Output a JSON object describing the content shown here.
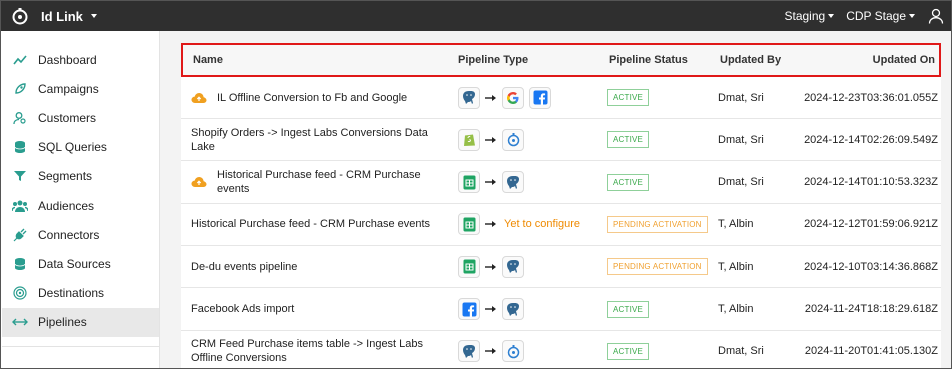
{
  "app": {
    "name": "Id Link"
  },
  "topbar": {
    "env1": "Staging",
    "env2": "CDP Stage"
  },
  "sidebar": {
    "items": [
      {
        "label": "Dashboard",
        "icon": "trend-line-icon"
      },
      {
        "label": "Campaigns",
        "icon": "rocket-icon"
      },
      {
        "label": "Customers",
        "icon": "user-search-icon"
      },
      {
        "label": "SQL Queries",
        "icon": "database-icon"
      },
      {
        "label": "Segments",
        "icon": "filter-icon"
      },
      {
        "label": "Audiences",
        "icon": "users-group-icon"
      },
      {
        "label": "Connectors",
        "icon": "plug-icon"
      },
      {
        "label": "Data Sources",
        "icon": "database-icon"
      },
      {
        "label": "Destinations",
        "icon": "target-icon"
      },
      {
        "label": "Pipelines",
        "icon": "horizontal-arrows-icon",
        "active": true
      }
    ]
  },
  "table": {
    "headers": {
      "name": "Name",
      "type": "Pipeline Type",
      "status": "Pipeline Status",
      "by": "Updated By",
      "on": "Updated On"
    },
    "rows": [
      {
        "name": "IL Offline Conversion to Fb and Google",
        "cloud": true,
        "source": "postgres",
        "dest": [
          "google",
          "facebook"
        ],
        "status": "ACTIVE",
        "by": "Dmat, Sri",
        "on": "2024-12-23T03:36:01.055Z"
      },
      {
        "name": "Shopify Orders -> Ingest Labs Conversions Data Lake",
        "cloud": false,
        "source": "shopify",
        "dest": [
          "ingestlabs"
        ],
        "status": "ACTIVE",
        "by": "Dmat, Sri",
        "on": "2024-12-14T02:26:09.549Z"
      },
      {
        "name": "Historical Purchase feed - CRM Purchase events",
        "cloud": true,
        "source": "sheets",
        "dest": [
          "postgres"
        ],
        "status": "ACTIVE",
        "by": "Dmat, Sri",
        "on": "2024-12-14T01:10:53.323Z"
      },
      {
        "name": "Historical Purchase feed - CRM Purchase events",
        "cloud": false,
        "source": "sheets",
        "dest": [],
        "yet": "Yet to configure",
        "status": "PENDING ACTIVATION",
        "by": "T, Albin",
        "on": "2024-12-12T01:59:06.921Z"
      },
      {
        "name": "De-du events pipeline",
        "cloud": false,
        "source": "sheets",
        "dest": [
          "postgres"
        ],
        "status": "PENDING ACTIVATION",
        "by": "T, Albin",
        "on": "2024-12-10T03:14:36.868Z"
      },
      {
        "name": "Facebook Ads import",
        "cloud": false,
        "source": "facebook",
        "dest": [
          "postgres"
        ],
        "status": "ACTIVE",
        "by": "T, Albin",
        "on": "2024-11-24T18:18:29.618Z"
      },
      {
        "name": "CRM Feed Purchase items table -> Ingest Labs Offline Conversions",
        "cloud": false,
        "source": "postgres",
        "dest": [
          "ingestlabs"
        ],
        "status": "ACTIVE",
        "by": "Dmat, Sri",
        "on": "2024-11-20T01:41:05.130Z"
      }
    ]
  },
  "colors": {
    "topbar": "#2f2f2f",
    "highlight": "#e01818",
    "active": "#3aa84a",
    "pending": "#f0a030",
    "yet": "#ef8a00"
  }
}
